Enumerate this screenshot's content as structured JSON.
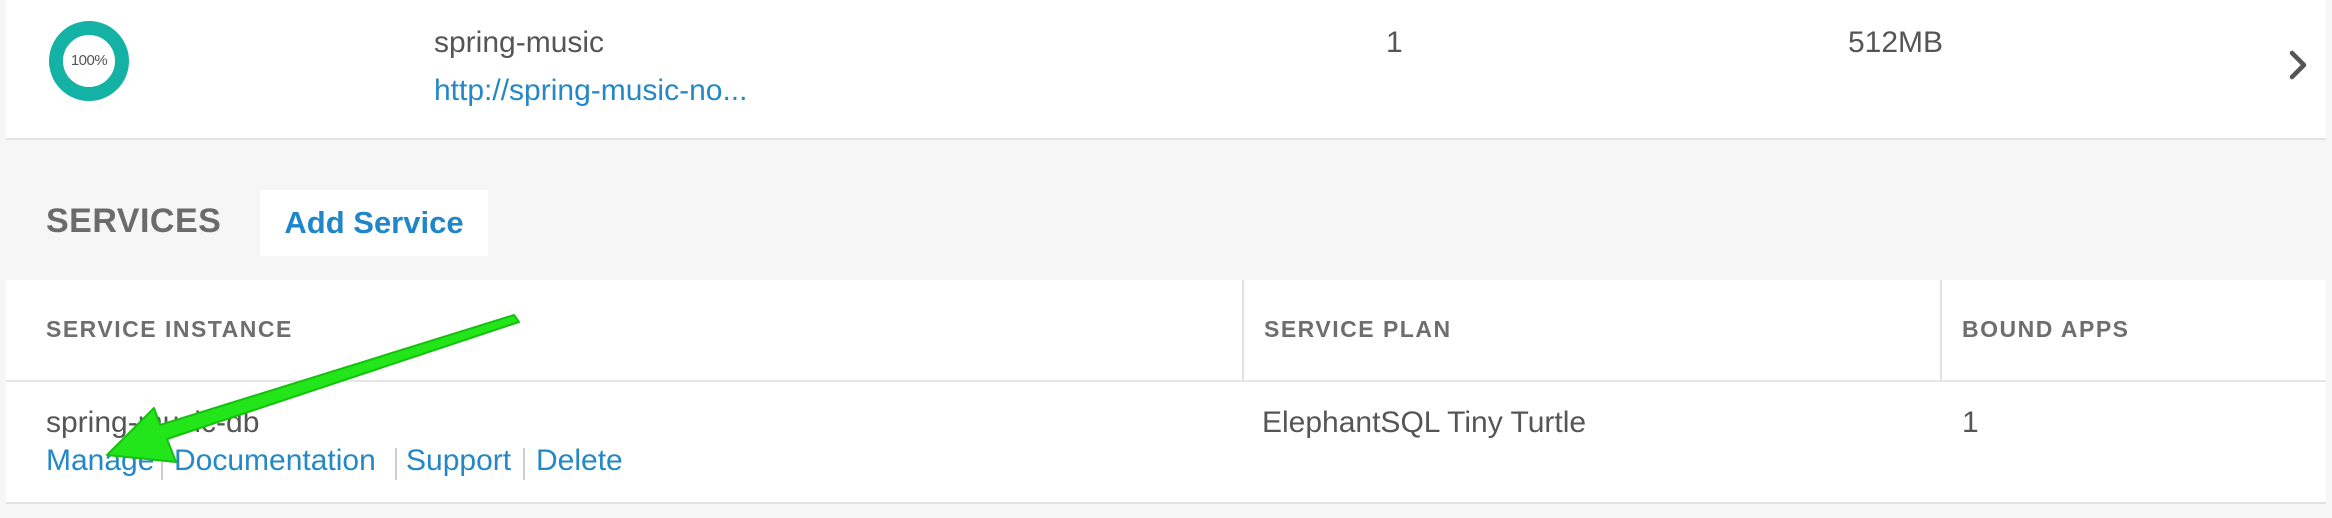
{
  "app_row": {
    "progress_label": "100%",
    "progress_fraction": 1.0,
    "progress_color": "#14b1a5",
    "name": "spring-music",
    "url": "http://spring-music-no...",
    "instances": "1",
    "memory": "512MB",
    "chevron_icon": "chevron-right-icon"
  },
  "services": {
    "title": "SERVICES",
    "add_label": "Add Service"
  },
  "table": {
    "headers": [
      "SERVICE INSTANCE",
      "SERVICE PLAN",
      "BOUND APPS"
    ],
    "rows": [
      {
        "instance": "spring-music-db",
        "plan": "ElephantSQL Tiny Turtle",
        "bound_apps": "1",
        "links": [
          "Manage",
          "Documentation",
          "Support",
          "Delete"
        ]
      }
    ]
  },
  "annotation": {
    "arrow_color": "#22e51a",
    "arrow_icon": "pointer-arrow-icon"
  },
  "colors": {
    "link": "#2488c6",
    "text": "#555555",
    "background": "#f6f6f6"
  }
}
